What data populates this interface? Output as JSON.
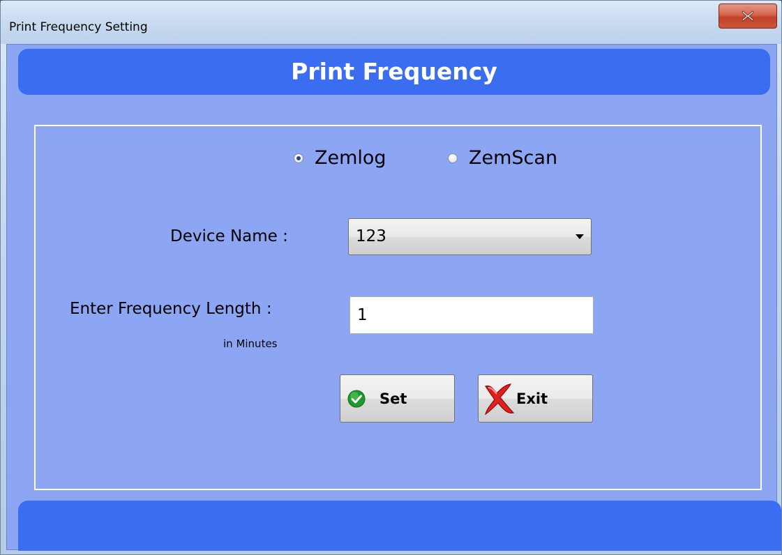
{
  "window": {
    "title": "Print Frequency Setting",
    "close_icon": "close-x-icon"
  },
  "header": {
    "title": "Print Frequency"
  },
  "radios": [
    {
      "label": "Zemlog",
      "checked": true
    },
    {
      "label": "ZemScan",
      "checked": false
    }
  ],
  "device": {
    "label": "Device Name :",
    "selected": "123"
  },
  "frequency": {
    "label": "Enter Frequency Length :",
    "unit": "in Minutes",
    "value": "1"
  },
  "buttons": {
    "set": {
      "label": "Set",
      "icon": "check-circle-icon"
    },
    "exit": {
      "label": "Exit",
      "icon": "red-x-icon"
    }
  },
  "colors": {
    "client_bg": "#8ca6f4",
    "bar_blue": "#3a6df0"
  }
}
